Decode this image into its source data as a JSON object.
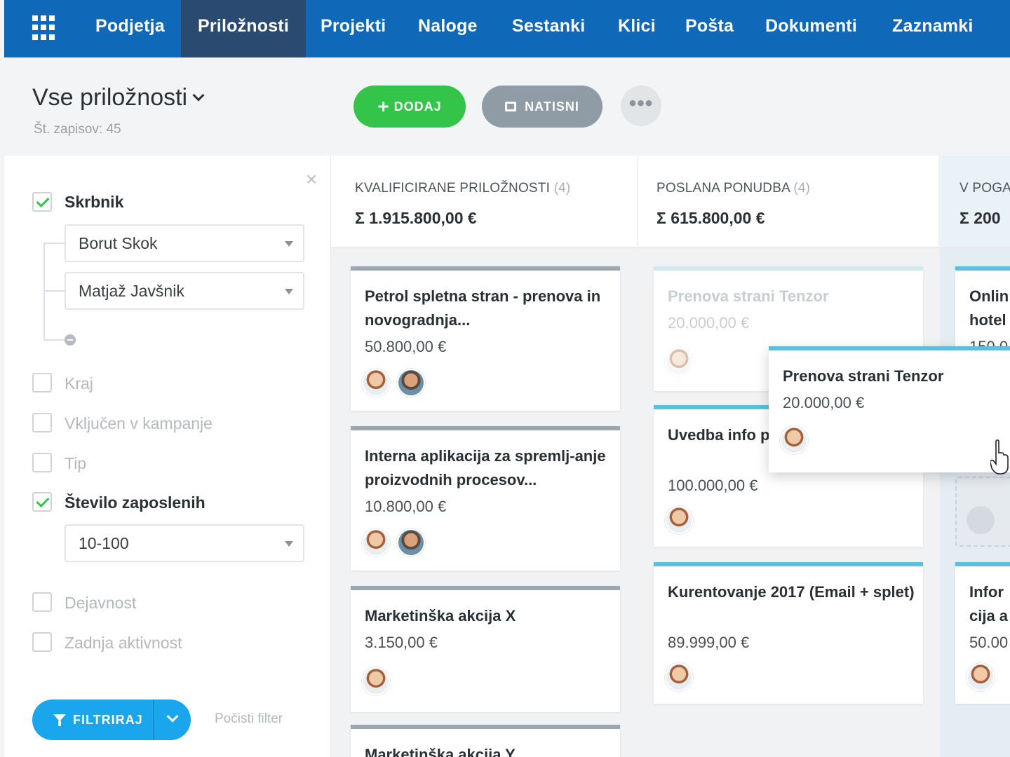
{
  "nav": {
    "items": [
      "Podjetja",
      "Priložnosti",
      "Projekti",
      "Naloge",
      "Sestanki",
      "Klici",
      "Pošta",
      "Dokumenti",
      "Zaznamki"
    ],
    "active": "Priložnosti"
  },
  "header": {
    "title": "Vse priložnosti",
    "record_count": "Št. zapisov: 45",
    "add_label": "DODAJ",
    "print_label": "NATISNI",
    "more_label": "•••"
  },
  "filters": {
    "close": "×",
    "owner": {
      "label": "Skrbnik",
      "checked": true,
      "values": [
        "Borut Skok",
        "Matjaž Javšnik"
      ]
    },
    "location": {
      "label": "Kraj",
      "checked": false
    },
    "campaign": {
      "label": "Vključen v kampanje",
      "checked": false
    },
    "type": {
      "label": "Tip",
      "checked": false
    },
    "employees": {
      "label": "Število zaposlenih",
      "checked": true,
      "value": "10-100"
    },
    "activity": {
      "label": "Dejavnost",
      "checked": false
    },
    "last_activity": {
      "label": "Zadnja aktivnost",
      "checked": false
    },
    "filter_button": "FILTRIRAJ",
    "clear_label": "Počisti filter"
  },
  "columns": [
    {
      "name": "KVALIFICIRANE PRILOŽNOSTI",
      "count": "(4)",
      "sum": "Σ 1.915.800,00 €",
      "cards": [
        {
          "title": "Petrol spletna stran - prenova in novogradnja...",
          "amount": "50.800,00 €"
        },
        {
          "title": "Interna aplikacija za spremlj-anje proizvodnih procesov...",
          "amount": "10.800,00 €"
        },
        {
          "title": "Marketinška akcija X",
          "amount": "3.150,00 €"
        },
        {
          "title": "Marketinška akcija Y",
          "amount": ""
        }
      ]
    },
    {
      "name": "POSLANA PONUDBA",
      "count": "(4)",
      "sum": "Σ 615.800,00 €",
      "cards": [
        {
          "title": "Prenova strani Tenzor",
          "amount": "20.000,00 €"
        },
        {
          "title": "Uvedba info proizvodnje",
          "amount": "100.000,00 €"
        },
        {
          "title": "Kurentovanje 2017 (Email + splet)",
          "amount": "89.999,00 €"
        }
      ]
    },
    {
      "name": "V POGA",
      "count": "",
      "sum": "Σ 200",
      "cards": [
        {
          "title": "Onlin hotel",
          "amount": "150.0"
        },
        {
          "title": "Infor cija a",
          "amount": "50.00"
        }
      ]
    }
  ],
  "drag_card": {
    "title": "Prenova strani Tenzor",
    "amount": "20.000,00 €"
  },
  "colors": {
    "nav_bg": "#1069b8",
    "nav_active": "#2a4a6f",
    "add_button": "#33c449",
    "filter_button": "#1aa6ec",
    "card_gray_bar": "#9aa7b2",
    "card_blue_bar": "#5bc0de"
  }
}
